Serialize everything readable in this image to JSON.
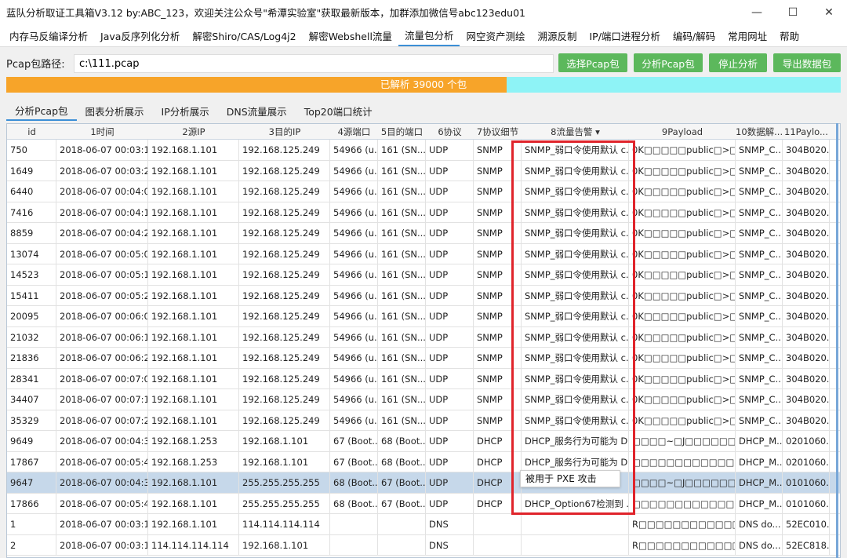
{
  "window": {
    "title": "蓝队分析取证工具箱V3.12 by:ABC_123，欢迎关注公众号\"希潭实验室\"获取最新版本，加群添加微信号abc123edu01",
    "minimize": "—",
    "maximize": "☐",
    "close": "✕"
  },
  "menu": [
    "内存马反编译分析",
    "Java反序列化分析",
    "解密Shiro/CAS/Log4j2",
    "解密Webshell流量",
    "流量包分析",
    "网空资产测绘",
    "溯源反制",
    "IP/端口进程分析",
    "编码/解码",
    "常用网址",
    "帮助"
  ],
  "path": {
    "label": "Pcap包路径:",
    "value": "c:\\111.pcap"
  },
  "buttons": {
    "select": "选择Pcap包",
    "analyze": "分析Pcap包",
    "stop": "停止分析",
    "export": "导出数据包"
  },
  "progress": {
    "text": "已解析 39000 个包",
    "percent": 60
  },
  "subtabs": [
    "分析Pcap包",
    "图表分析展示",
    "IP分析展示",
    "DNS流量展示",
    "Top20端口统计"
  ],
  "table": {
    "headers": [
      "id",
      "1时间",
      "2源IP",
      "3目的IP",
      "4源端口",
      "5目的端口",
      "6协议",
      "7协议细节",
      "8流量告警 ▾",
      "9Payload",
      "10数据解...",
      "11Paylo..."
    ],
    "rows": [
      [
        "750",
        "2018-06-07 00:03:17...",
        "192.168.1.101",
        "192.168.125.249",
        "54966 (u...",
        "161 (SN...",
        "UDP",
        "SNMP",
        "SNMP_弱口令使用默认 c...",
        "0K□□□□□public□>□□F...",
        "SNMP_C...",
        "304B020..."
      ],
      [
        "1649",
        "2018-06-07 00:03:27...",
        "192.168.1.101",
        "192.168.125.249",
        "54966 (u...",
        "161 (SN...",
        "UDP",
        "SNMP",
        "SNMP_弱口令使用默认 c...",
        "0K□□□□□public□>□□F...",
        "SNMP_C...",
        "304B020..."
      ],
      [
        "6440",
        "2018-06-07 00:04:07...",
        "192.168.1.101",
        "192.168.125.249",
        "54966 (u...",
        "161 (SN...",
        "UDP",
        "SNMP",
        "SNMP_弱口令使用默认 c...",
        "0K□□□□□public□>□□G...",
        "SNMP_C...",
        "304B020..."
      ],
      [
        "7416",
        "2018-06-07 00:04:17...",
        "192.168.1.101",
        "192.168.125.249",
        "54966 (u...",
        "161 (SN...",
        "UDP",
        "SNMP",
        "SNMP_弱口令使用默认 c...",
        "0K□□□□□public□>□□G...",
        "SNMP_C...",
        "304B020..."
      ],
      [
        "8859",
        "2018-06-07 00:04:27...",
        "192.168.1.101",
        "192.168.125.249",
        "54966 (u...",
        "161 (SN...",
        "UDP",
        "SNMP",
        "SNMP_弱口令使用默认 c...",
        "0K□□□□□public□>□□G...",
        "SNMP_C...",
        "304B020..."
      ],
      [
        "13074",
        "2018-06-07 00:05:07...",
        "192.168.1.101",
        "192.168.125.249",
        "54966 (u...",
        "161 (SN...",
        "UDP",
        "SNMP",
        "SNMP_弱口令使用默认 c...",
        "0K□□□□□public□>□□H...",
        "SNMP_C...",
        "304B020..."
      ],
      [
        "14523",
        "2018-06-07 00:05:17...",
        "192.168.1.101",
        "192.168.125.249",
        "54966 (u...",
        "161 (SN...",
        "UDP",
        "SNMP",
        "SNMP_弱口令使用默认 c...",
        "0K□□□□□public□>□□H...",
        "SNMP_C...",
        "304B020..."
      ],
      [
        "15411",
        "2018-06-07 00:05:27...",
        "192.168.1.101",
        "192.168.125.249",
        "54966 (u...",
        "161 (SN...",
        "UDP",
        "SNMP",
        "SNMP_弱口令使用默认 c...",
        "0K□□□□□public□>□□H...",
        "SNMP_C...",
        "304B020..."
      ],
      [
        "20095",
        "2018-06-07 00:06:07...",
        "192.168.1.101",
        "192.168.125.249",
        "54966 (u...",
        "161 (SN...",
        "UDP",
        "SNMP",
        "SNMP_弱口令使用默认 c...",
        "0K□□□□□public□>□□I...",
        "SNMP_C...",
        "304B020..."
      ],
      [
        "21032",
        "2018-06-07 00:06:17...",
        "192.168.1.101",
        "192.168.125.249",
        "54966 (u...",
        "161 (SN...",
        "UDP",
        "SNMP",
        "SNMP_弱口令使用默认 c...",
        "0K□□□□□public□>□□I...",
        "SNMP_C...",
        "304B020..."
      ],
      [
        "21836",
        "2018-06-07 00:06:27...",
        "192.168.1.101",
        "192.168.125.249",
        "54966 (u...",
        "161 (SN...",
        "UDP",
        "SNMP",
        "SNMP_弱口令使用默认 c...",
        "0K□□□□□public□>□□I...",
        "SNMP_C...",
        "304B020..."
      ],
      [
        "28341",
        "2018-06-07 00:07:07...",
        "192.168.1.101",
        "192.168.125.249",
        "54966 (u...",
        "161 (SN...",
        "UDP",
        "SNMP",
        "SNMP_弱口令使用默认 c...",
        "0K□□□□□public□>□□J...",
        "SNMP_C...",
        "304B020..."
      ],
      [
        "34407",
        "2018-06-07 00:07:17...",
        "192.168.1.101",
        "192.168.125.249",
        "54966 (u...",
        "161 (SN...",
        "UDP",
        "SNMP",
        "SNMP_弱口令使用默认 c...",
        "0K□□□□□public□>□□J...",
        "SNMP_C...",
        "304B020..."
      ],
      [
        "35329",
        "2018-06-07 00:07:27...",
        "192.168.1.101",
        "192.168.125.249",
        "54966 (u...",
        "161 (SN...",
        "UDP",
        "SNMP",
        "SNMP_弱口令使用默认 c...",
        "0K□□□□□public□>□□J...",
        "SNMP_C...",
        "304B020..."
      ],
      [
        "9649",
        "2018-06-07 00:04:34...",
        "192.168.1.253",
        "192.168.1.101",
        "67 (Boot...",
        "68 (Boot...",
        "UDP",
        "DHCP",
        "DHCP_服务行为可能为 D...",
        "□□□□~□J□□□□□□□□□e...",
        "DHCP_M...",
        "0201060..."
      ],
      [
        "17867",
        "2018-06-07 00:05:49...",
        "192.168.1.253",
        "192.168.1.101",
        "67 (Boot...",
        "68 (Boot...",
        "UDP",
        "DHCP",
        "DHCP_服务行为可能为 D...",
        "□□□□□□□□□□□□□□□□e...",
        "DHCP_M...",
        "0201060..."
      ],
      [
        "9647",
        "2018-06-07 00:04:34...",
        "192.168.1.101",
        "255.255.255.255",
        "68 (Boot...",
        "67 (Boot...",
        "UDP",
        "DHCP",
        "",
        "□□□□~□J□□□□□□□□□e...",
        "DHCP_M...",
        "0101060..."
      ],
      [
        "17866",
        "2018-06-07 00:05:49...",
        "192.168.1.101",
        "255.255.255.255",
        "68 (Boot...",
        "67 (Boot...",
        "UDP",
        "DHCP",
        "DHCP_Option67检测到 ...",
        "□□□□□□□□□□□□□□□□e...",
        "DHCP_M...",
        "0101060..."
      ],
      [
        "1",
        "2018-06-07 00:03:10...",
        "192.168.1.101",
        "114.114.114.114",
        "",
        "",
        "DNS",
        "",
        "",
        "R□□□□□□□□□□□□□□9040...",
        "DNS do...",
        "52EC010..."
      ],
      [
        "2",
        "2018-06-07 00:03:10...",
        "114.114.114.114",
        "192.168.1.101",
        "",
        "",
        "DNS",
        "",
        "",
        "R□□□□□□□□□□□□□90409...",
        "DNS do...",
        "52EC818..."
      ]
    ],
    "selected_row": 16
  },
  "tooltip": "被用于 PXE 攻击",
  "colors": {
    "progress_done": "#f7a429",
    "progress_rest": "#8ef3f6",
    "button": "#5cb85c",
    "highlight": "#e0242b",
    "selected": "#c6d8ea"
  }
}
